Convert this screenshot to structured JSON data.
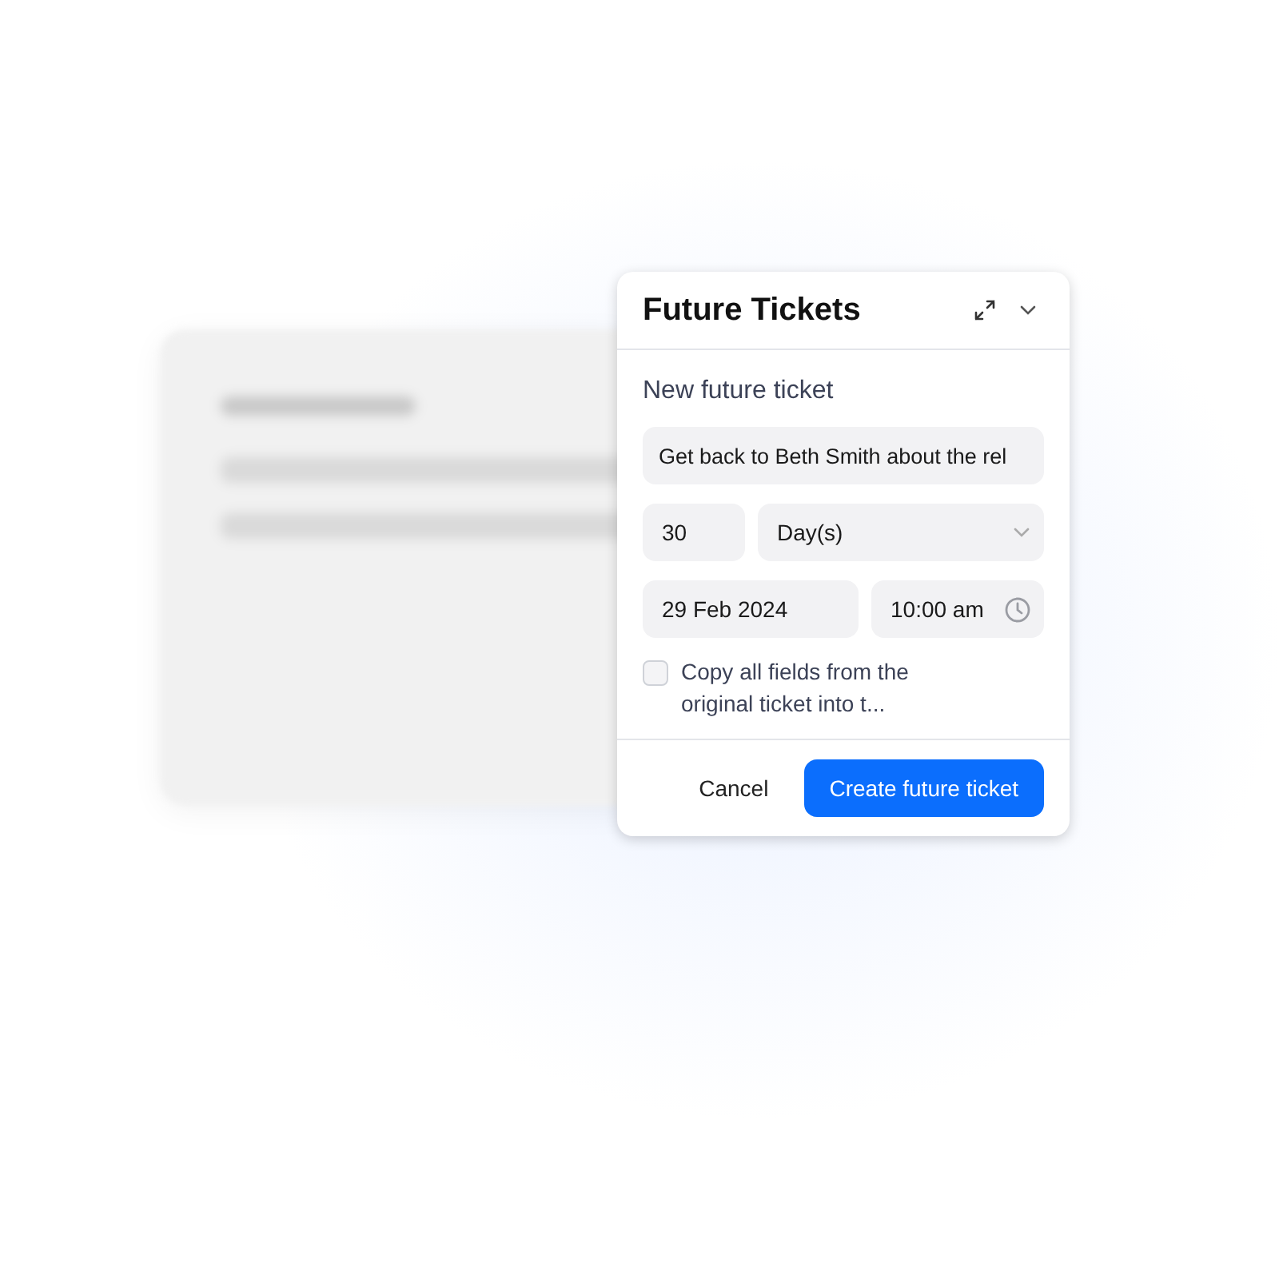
{
  "dialog": {
    "title": "Future Tickets",
    "subtitle": "New future ticket",
    "summary": {
      "value": "Get back to Beth Smith about the rel"
    },
    "interval": {
      "value": "30"
    },
    "unit": {
      "value": "Day(s)"
    },
    "date": {
      "value": "29 Feb 2024"
    },
    "time": {
      "value": "10:00 am"
    },
    "copy_fields": {
      "label": "Copy all fields from the original ticket into t...",
      "checked": false
    },
    "buttons": [
      {
        "label": "Cancel",
        "kind": "secondary"
      },
      {
        "label": "Create future ticket",
        "kind": "primary"
      }
    ]
  }
}
